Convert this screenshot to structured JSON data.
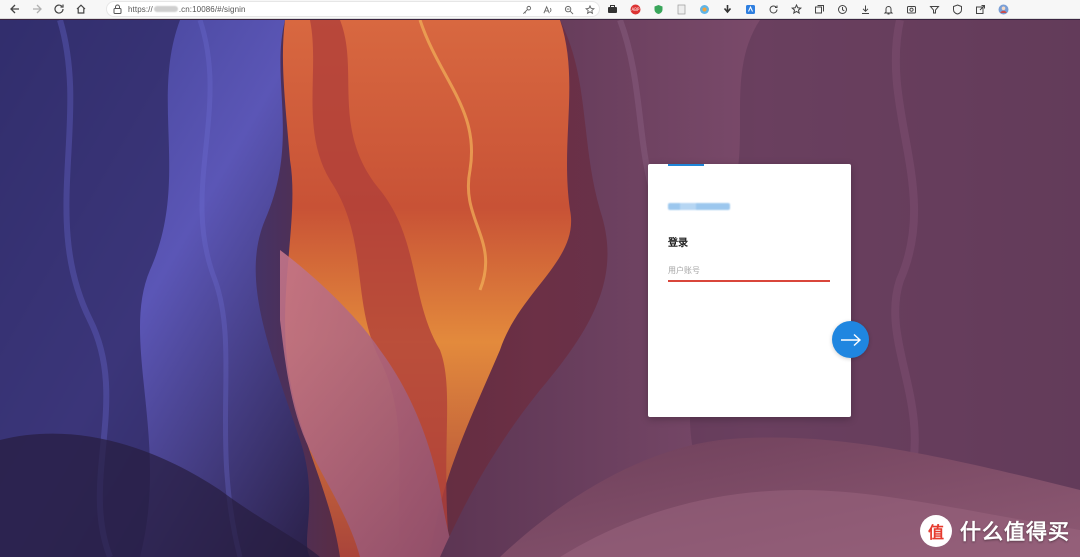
{
  "browser": {
    "url_prefix": "https://",
    "url_suffix": ".cn:10086/#/signin"
  },
  "login": {
    "title": "登录",
    "username_placeholder": "用户账号"
  },
  "watermark": {
    "text": "什么值得买",
    "logo_glyph": "值"
  },
  "colors": {
    "accent": "#1f86e0",
    "input_underline": "#d9463b",
    "card_bg": "#ffffff"
  }
}
